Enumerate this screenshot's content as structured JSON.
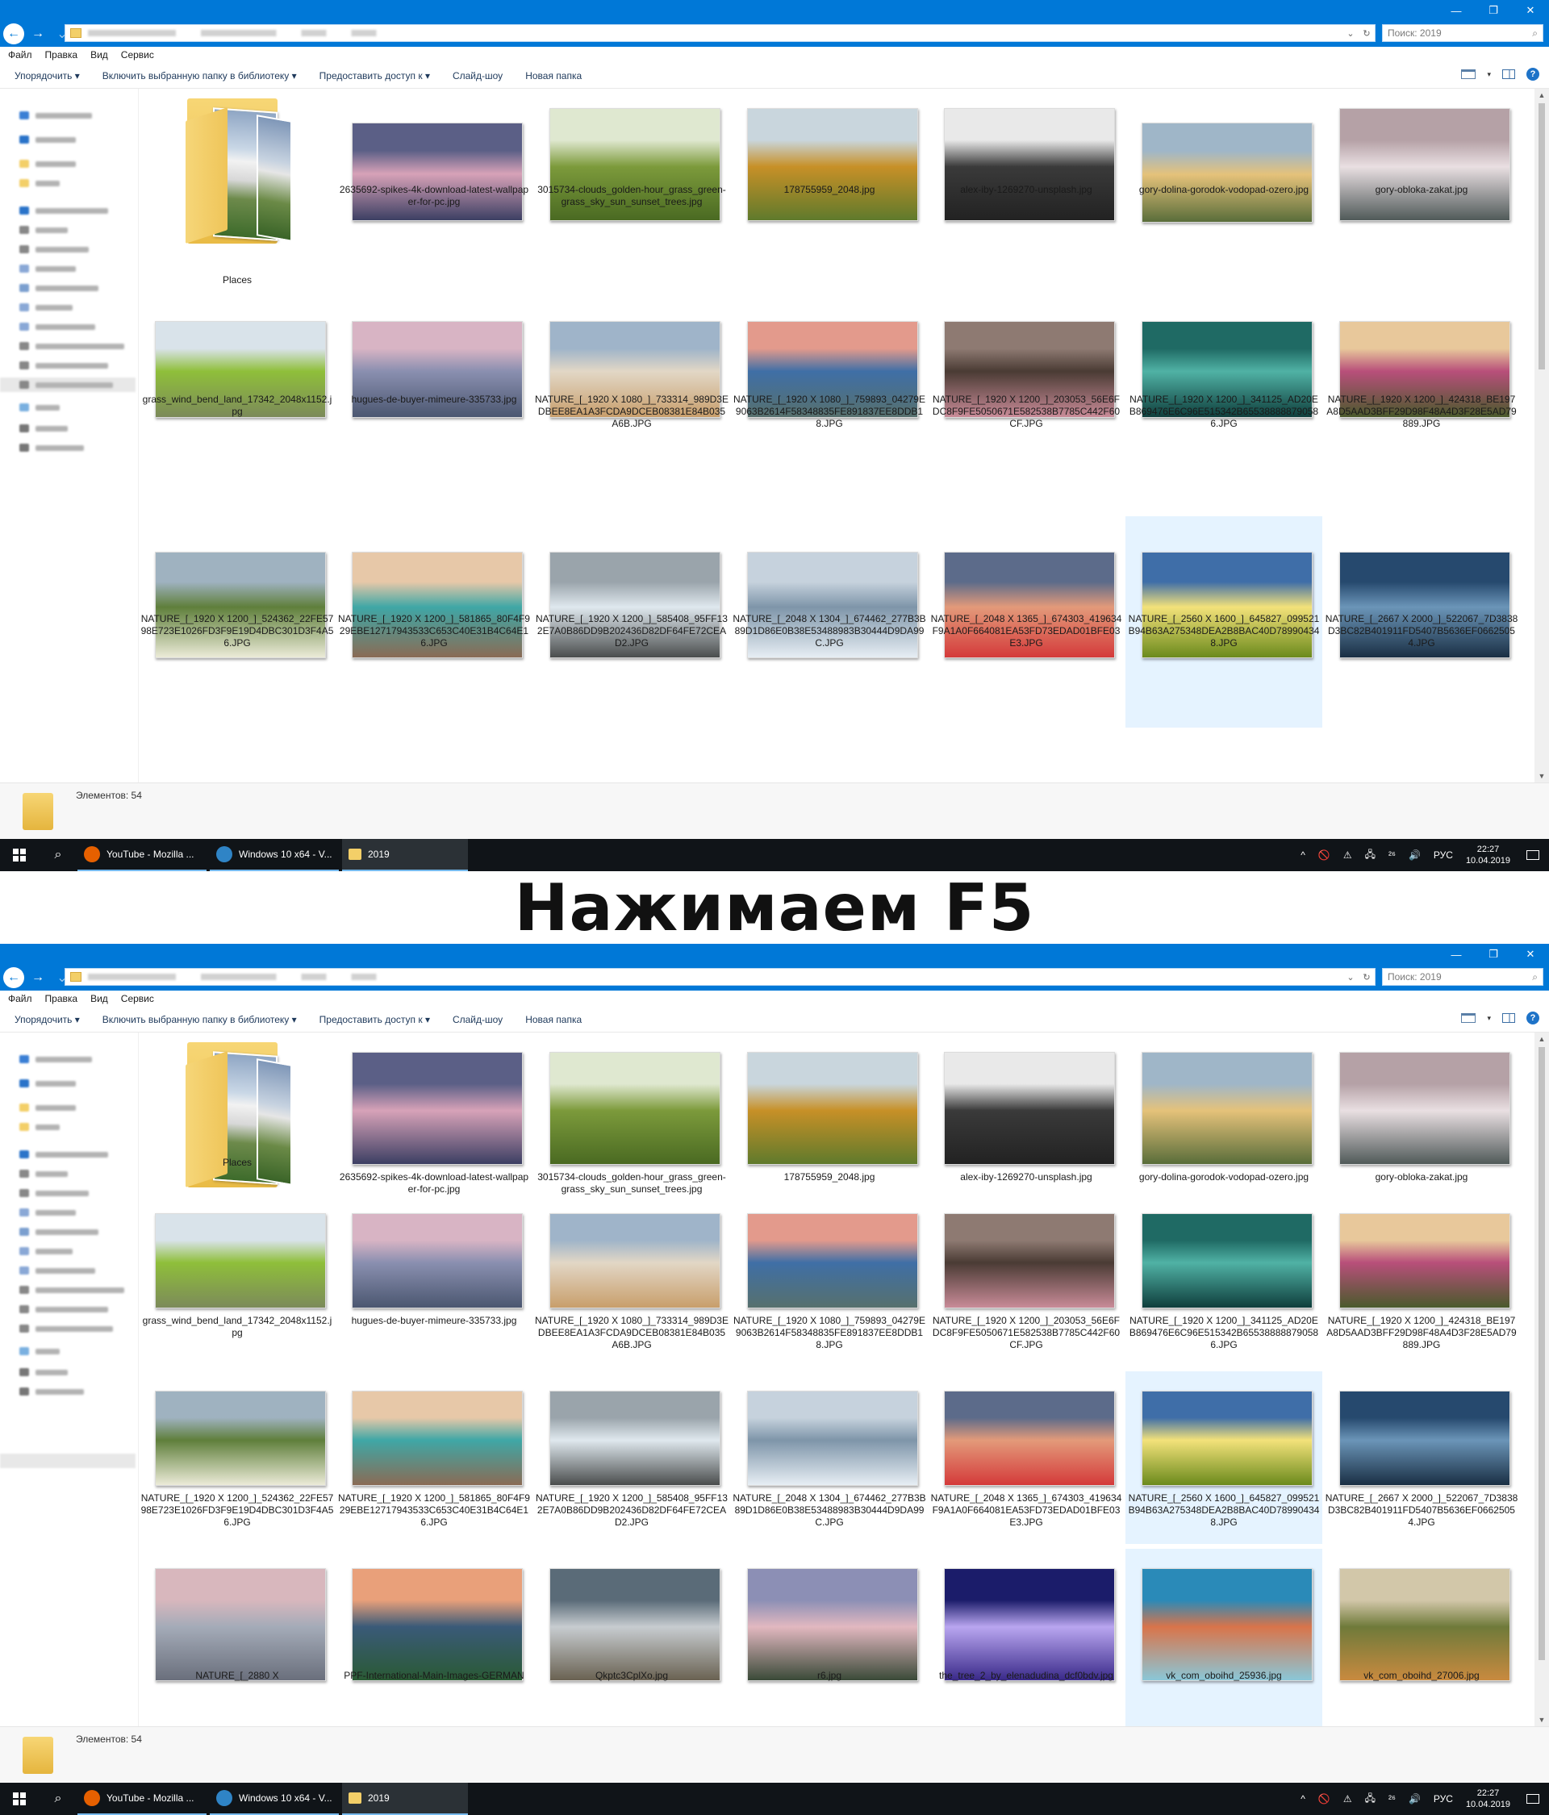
{
  "caption": "Нажимаем F5",
  "window": {
    "controls": [
      "—",
      "❐",
      "✕"
    ],
    "search_placeholder": "Поиск: 2019",
    "menu": [
      "Файл",
      "Правка",
      "Вид",
      "Сервис"
    ],
    "commands": [
      "Упорядочить ▾",
      "Включить выбранную папку в библиотеку ▾",
      "Предоставить доступ к ▾",
      "Слайд-шоу",
      "Новая папка"
    ],
    "status_items": "Элементов: 54"
  },
  "taskbar": {
    "apps": [
      {
        "label": "YouTube - Mozilla ...",
        "icon": "firefox-icon",
        "color": "#e66000"
      },
      {
        "label": "Windows 10 x64 - V...",
        "icon": "virtualbox-icon",
        "color": "#2f84c6"
      },
      {
        "label": "2019",
        "icon": "folder-icon",
        "color": "#f3cf68"
      }
    ],
    "tray": [
      "^",
      "🚫",
      "⚠",
      "🖧",
      "²⁶",
      "🔊"
    ],
    "lang": "РУС",
    "time": "22:27",
    "date": "10.04.2019"
  },
  "files": [
    {
      "name": "Places",
      "kind": "folder"
    },
    {
      "name": "2635692-spikes-4k-download-latest-wallpaper-for-pc.jpg",
      "c1": "#5b5f86",
      "c2": "#d7a2b8",
      "c3": "#3c3f63"
    },
    {
      "name": "3015734-clouds_golden-hour_grass_green-grass_sky_sun_sunset_trees.jpg",
      "c1": "#dfe8d0",
      "c2": "#7c9a3b",
      "c3": "#4a6a22"
    },
    {
      "name": "178755959_2048.jpg",
      "c1": "#c9d6dd",
      "c2": "#c79027",
      "c3": "#5f7a2c"
    },
    {
      "name": "alex-iby-1269270-unsplash.jpg",
      "c1": "#e9e9e9",
      "c2": "#3a3a3a",
      "c3": "#222222"
    },
    {
      "name": "gory-dolina-gorodok-vodopad-ozero.jpg",
      "c1": "#9fb6c8",
      "c2": "#e5c27a",
      "c3": "#596d3a"
    },
    {
      "name": "gory-obloka-zakat.jpg",
      "c1": "#b5a1a6",
      "c2": "#e9dfe2",
      "c3": "#505a59"
    },
    {
      "name": "grass_wind_bend_land_17342_2048x1152.jpg",
      "c1": "#d9e3ea",
      "c2": "#8fbf3a",
      "c3": "#7c8a5a"
    },
    {
      "name": "hugues-de-buyer-mimeure-335733.jpg",
      "c1": "#d8b4c4",
      "c2": "#8a8fb0",
      "c3": "#4b5770"
    },
    {
      "name": "NATURE_[_1920 X 1080_]_733314_989D3EDBEE8EA1A3FCDA9DCEB08381E84B035A6B.JPG",
      "c1": "#9fb4c9",
      "c2": "#e2d7c6",
      "c3": "#c89e6b"
    },
    {
      "name": "NATURE_[_1920 X 1080_]_759893_04279E9063B2614F58348835FE891837EE8DDB18.JPG",
      "c1": "#e39a8c",
      "c2": "#3f6fa6",
      "c3": "#57706d"
    },
    {
      "name": "NATURE_[_1920 X 1200_]_203053_56E6FDC8F9FE5050671E582538B7785C442F60CF.JPG",
      "c1": "#8e7a72",
      "c2": "#4a3b34",
      "c3": "#c98b98"
    },
    {
      "name": "NATURE_[_1920 X 1200_]_341125_AD20EB869476E6C96E515342B655388888790586.JPG",
      "c1": "#1f6a64",
      "c2": "#50b2a5",
      "c3": "#0f3e3c"
    },
    {
      "name": "NATURE_[_1920 X 1200_]_424318_BE197A8D5AAD3BFF29D98F48A4D3F28E5AD79889.JPG",
      "c1": "#e8c89b",
      "c2": "#b84f7a",
      "c3": "#4a5a2c"
    },
    {
      "name": "NATURE_[_1920 X 1200_]_524362_22FE5798E723E1026FD3F9E19D4DBC301D3F4A56.JPG",
      "c1": "#9fb2c0",
      "c2": "#5f7f3b",
      "c3": "#ecebd8"
    },
    {
      "name": "NATURE_[_1920 X 1200_]_581865_80F4F929EBE12717943533C653C40E31B4C64E16.JPG",
      "c1": "#e7c8a8",
      "c2": "#3fa7a6",
      "c3": "#8a6b55"
    },
    {
      "name": "NATURE_[_1920 X 1200_]_585408_95FF132E7A0B86DD9B202436D82DF64FE72CEAD2.JPG",
      "c1": "#9aa4ab",
      "c2": "#dfe8ee",
      "c3": "#4a4d4d"
    },
    {
      "name": "NATURE_[_2048 X 1304_]_674462_277B3B89D1D86E0B38E53488983B30444D9DA99C.JPG",
      "c1": "#c6d2dd",
      "c2": "#7e95a9",
      "c3": "#e7eef4"
    },
    {
      "name": "NATURE_[_2048 X 1365_]_674303_419634F9A1A0F664081EA53FD73EDAD01BFE03E3.JPG",
      "c1": "#5c6b8a",
      "c2": "#e39a7a",
      "c3": "#d43a3a"
    },
    {
      "name": "NATURE_[_2560 X 1600_]_645827_099521B94B63A275348DEA2B8BAC40D789904348.JPG",
      "c1": "#3f6ea8",
      "c2": "#f3e27a",
      "c3": "#6b8a1c",
      "selected": true
    },
    {
      "name": "NATURE_[_2667 X 2000_]_522067_7D3838D3BC82B401911FD5407B5636EF06625054.JPG",
      "c1": "#26496e",
      "c2": "#6b95b8",
      "c3": "#1a2f44"
    }
  ],
  "extra_files": [
    {
      "name": "NATURE_[_2880 X",
      "c1": "#d8b7bd",
      "c2": "#a4abb8",
      "c3": "#6a6f7c"
    },
    {
      "name": "PPF-International-Main-Images-GERMAN",
      "c1": "#e9a07a",
      "c2": "#3a5a78",
      "c3": "#2a5a34"
    },
    {
      "name": "Qkptc3CplXo.jpg",
      "c1": "#5a6b78",
      "c2": "#c7ccd0",
      "c3": "#6a6252"
    },
    {
      "name": "r6.jpg",
      "c1": "#8c8fb5",
      "c2": "#e2b8c0",
      "c3": "#3a4a38"
    },
    {
      "name": "the_tree_2_by_elenadudina_dcf0bdv.jpg",
      "c1": "#1b1c6a",
      "c2": "#b9a6f0",
      "c3": "#3a2a8a"
    },
    {
      "name": "vk_com_oboihd_25936.jpg",
      "c1": "#2a8ab8",
      "c2": "#d9744a",
      "c3": "#8ac7d8",
      "selected": true
    },
    {
      "name": "vk_com_oboihd_27006.jpg",
      "c1": "#d2c7a9",
      "c2": "#6f7a3a",
      "c3": "#c98a3f"
    }
  ]
}
